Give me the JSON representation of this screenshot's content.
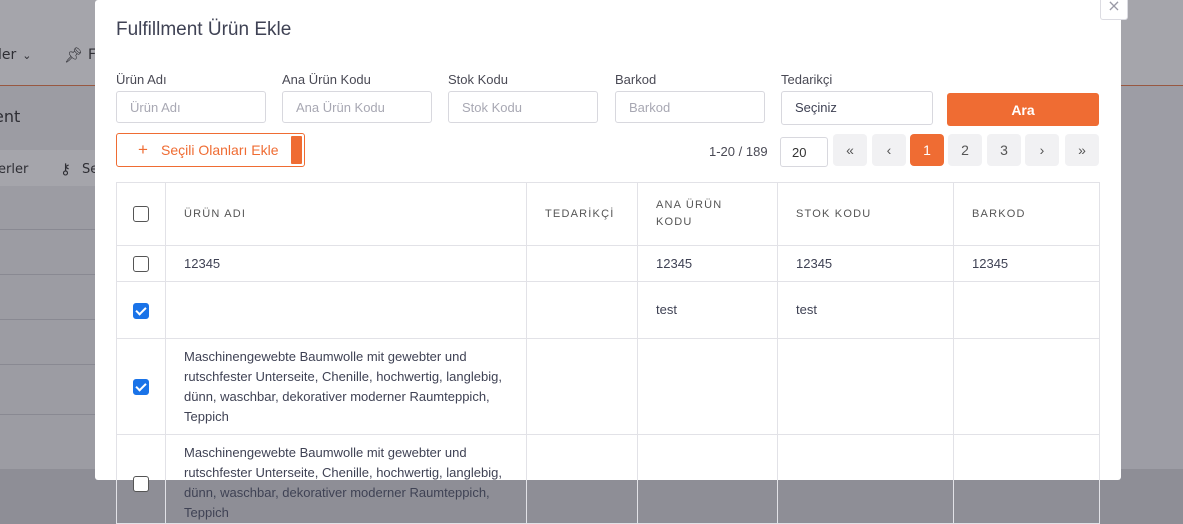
{
  "background": {
    "top_menu_partial": "ler",
    "pin_label_partial": "F",
    "page_title_partial": "ent",
    "toolbar_partial": "erler",
    "toolbar_key_label_partial": "Se"
  },
  "modal": {
    "title": "Fulfillment Ürün Ekle",
    "close_label": "×",
    "filters": {
      "product_name": {
        "label": "Ürün Adı",
        "placeholder": "Ürün Adı"
      },
      "main_product_code": {
        "label": "Ana Ürün Kodu",
        "placeholder": "Ana Ürün Kodu"
      },
      "stock_code": {
        "label": "Stok Kodu",
        "placeholder": "Stok Kodu"
      },
      "barcode": {
        "label": "Barkod",
        "placeholder": "Barkod"
      },
      "supplier": {
        "label": "Tedarikçi",
        "value": "Seçiniz"
      }
    },
    "search_button": "Ara",
    "add_selected_button": "Seçili Olanları Ekle",
    "add_selected_icon": "plus-icon",
    "pagination": {
      "info": "1-20 / 189",
      "page_size": "20",
      "first": "«",
      "prev": "‹",
      "pages": [
        "1",
        "2",
        "3"
      ],
      "active_page": "1",
      "next": "›",
      "last": "»"
    },
    "table": {
      "headers": [
        "ÜRÜN ADI",
        "TEDARİKÇİ",
        "ANA ÜRÜN KODU",
        "STOK KODU",
        "BARKOD"
      ],
      "rows": [
        {
          "checked": false,
          "name": "12345",
          "supplier": "",
          "main_code": "12345",
          "stock_code": "12345",
          "barcode": "12345"
        },
        {
          "checked": true,
          "name": "",
          "supplier": "",
          "main_code": "test",
          "stock_code": "test",
          "barcode": ""
        },
        {
          "checked": true,
          "name": "Maschinengewebte Baumwolle mit gewebter und rutschfester Unterseite, Chenille, hochwertig, langlebig, dünn, waschbar, dekorativer moderner Raumteppich, Teppich",
          "supplier": "",
          "main_code": "",
          "stock_code": "",
          "barcode": ""
        },
        {
          "checked": false,
          "name": "Maschinengewebte Baumwolle mit gewebter und rutschfester Unterseite, Chenille, hochwertig, langlebig, dünn, waschbar, dekorativer moderner Raumteppich, Teppich",
          "supplier": "",
          "main_code": "",
          "stock_code": "",
          "barcode": ""
        }
      ]
    }
  },
  "colors": {
    "accent": "#ef6c33",
    "checkbox_checked": "#1a73e8"
  }
}
